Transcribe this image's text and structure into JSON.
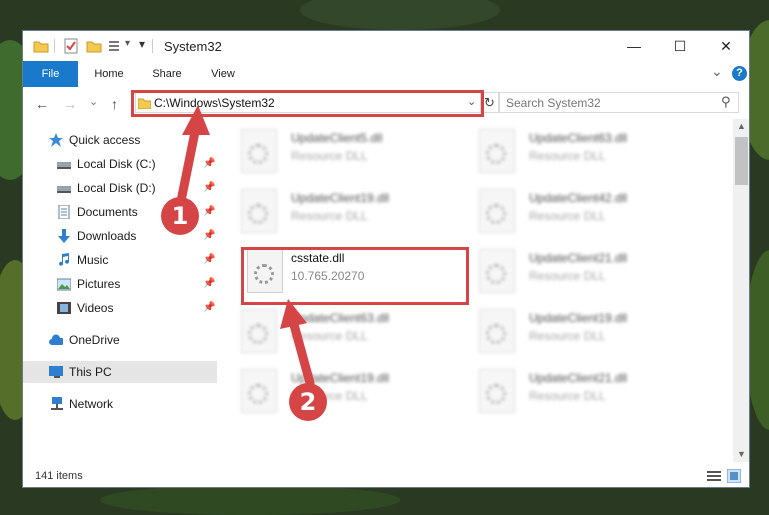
{
  "window": {
    "title": "System32",
    "minimize_glyph": "—",
    "maximize_glyph": "☐",
    "close_glyph": "✕"
  },
  "ribbon": {
    "tabs": [
      "File",
      "Home",
      "Share",
      "View"
    ],
    "collapse_glyph": "⌄",
    "help_glyph": "?"
  },
  "navigation": {
    "back_glyph": "←",
    "forward_glyph": "→",
    "recent_glyph": "⌄",
    "up_glyph": "↑",
    "address_path": "C:\\Windows\\System32",
    "address_dropdown_glyph": "⌄",
    "refresh_glyph": "↻",
    "search_placeholder": "Search System32",
    "search_glyph": "⚲"
  },
  "sidebar": {
    "quick_access": "Quick access",
    "items": [
      {
        "label": "Local Disk (C:)",
        "icon": "drive-icon"
      },
      {
        "label": "Local Disk (D:)",
        "icon": "drive-icon"
      },
      {
        "label": "Documents",
        "icon": "documents-icon"
      },
      {
        "label": "Downloads",
        "icon": "downloads-icon"
      },
      {
        "label": "Music",
        "icon": "music-icon"
      },
      {
        "label": "Pictures",
        "icon": "pictures-icon"
      },
      {
        "label": "Videos",
        "icon": "videos-icon"
      }
    ],
    "pin_glyph": "📌",
    "onedrive": "OneDrive",
    "this_pc": "This PC",
    "network": "Network"
  },
  "files": {
    "left": [
      {
        "name": "UpdateClient5.dll",
        "sub": "Resource DLL"
      },
      {
        "name": "UpdateClient19.dll",
        "sub": "Resource DLL"
      },
      {
        "name": "csstate.dll",
        "sub": "10.765.20270"
      },
      {
        "name": "UpdateClient63.dll",
        "sub": "Resource DLL"
      },
      {
        "name": "UpdateClient19.dll",
        "sub": "Resource DLL"
      }
    ],
    "right": [
      {
        "name": "UpdateClient63.dll",
        "sub": "Resource DLL"
      },
      {
        "name": "UpdateClient42.dll",
        "sub": "Resource DLL"
      },
      {
        "name": "UpdateClient21.dll",
        "sub": "Resource DLL"
      },
      {
        "name": "UpdateClient19.dll",
        "sub": "Resource DLL"
      },
      {
        "name": "UpdateClient21.dll",
        "sub": "Resource DLL"
      }
    ]
  },
  "status": {
    "item_count": "141 items"
  },
  "callouts": [
    "1",
    "2"
  ],
  "colors": {
    "accent": "#1979ca",
    "highlight": "#d64545"
  }
}
